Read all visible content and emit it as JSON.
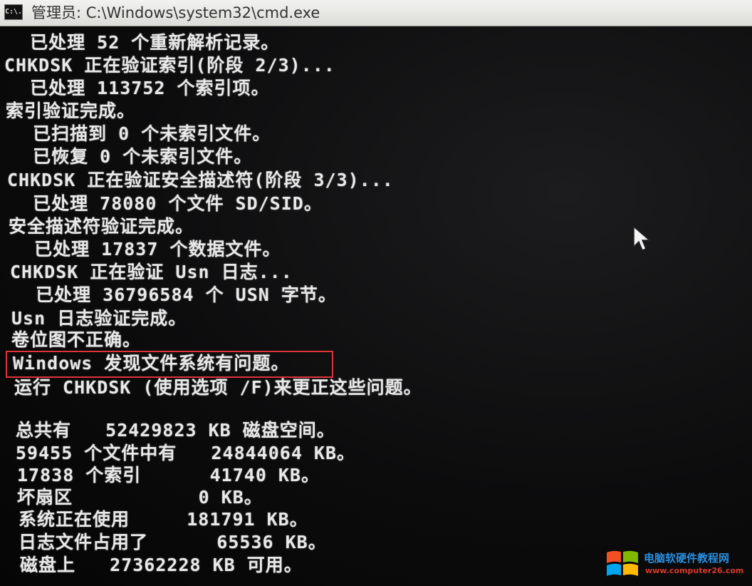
{
  "window": {
    "icon_label": "C:\\.",
    "title": "管理员: C:\\Windows\\system32\\cmd.exe"
  },
  "console": {
    "lines": [
      "  已处理 52 个重新解析记录。",
      "CHKDSK 正在验证索引(阶段 2/3)...",
      "  已处理 113752 个索引项。",
      "索引验证完成。",
      "  已扫描到 0 个未索引文件。",
      "  已恢复 0 个未索引文件。",
      "CHKDSK 正在验证安全描述符(阶段 3/3)...",
      "  已处理 78080 个文件 SD/SID。",
      "安全描述符验证完成。",
      "  已处理 17837 个数据文件。",
      "CHKDSK 正在验证 Usn 日志...",
      "  已处理 36796584 个 USN 字节。",
      "Usn 日志验证完成。",
      "卷位图不正确。",
      "Windows 发现文件系统有问题。",
      "运行 CHKDSK (使用选项 /F)来更正这些问题。",
      "总共有   52429823 KB 磁盘空间。",
      "59455 个文件中有   24844064 KB。",
      "17838 个索引      41740 KB。",
      "坏扇区           0 KB。",
      "系统正在使用     181791 KB。",
      "日志文件占用了      65536 KB。",
      "磁盘上   27362228 KB 可用。"
    ]
  },
  "watermark": {
    "site_name": "电脑软硬件教程网",
    "url": "www.computer26.com",
    "colors": [
      "#f25022",
      "#7fba00",
      "#00a4ef",
      "#ffb900"
    ]
  },
  "colors": {
    "console_text": "#e8e8e8",
    "highlight": "#e0323a"
  }
}
